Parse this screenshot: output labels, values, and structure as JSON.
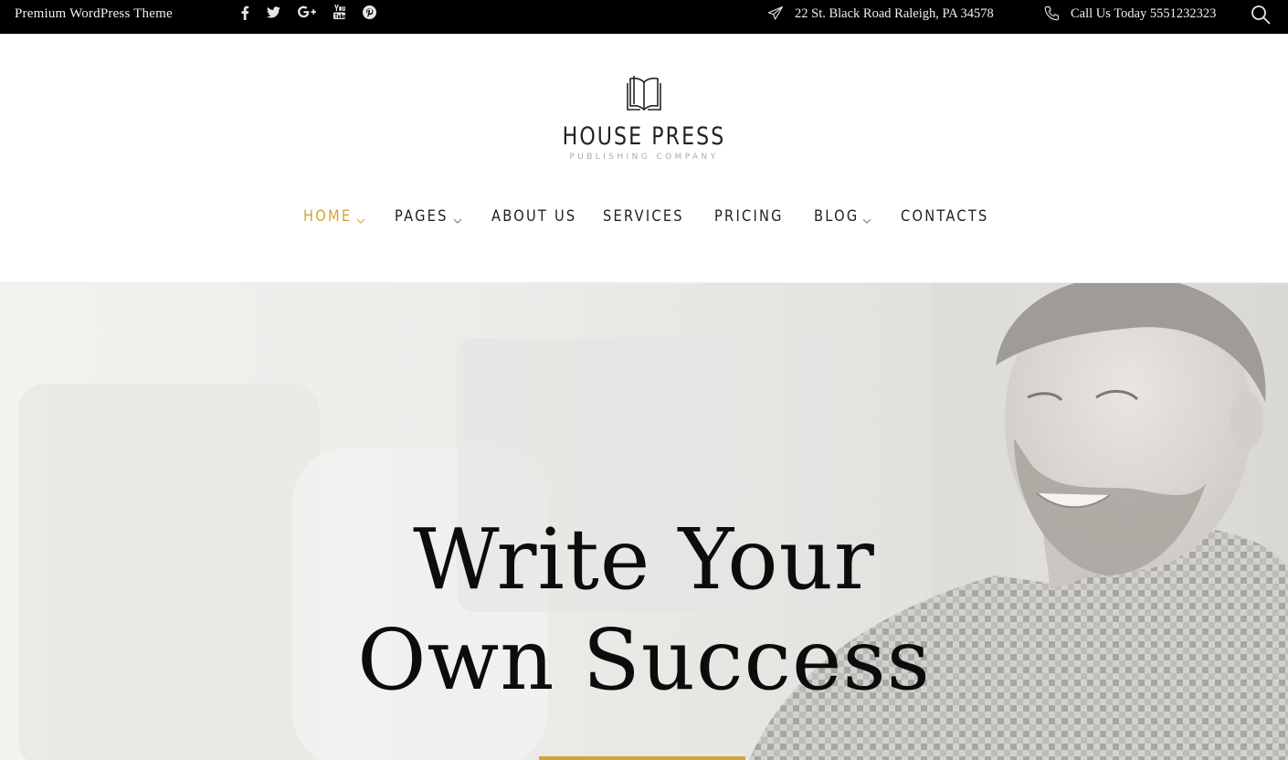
{
  "topbar": {
    "tagline": "Premium WordPress Theme",
    "social": [
      {
        "icon": "facebook-icon",
        "glyph": "f"
      },
      {
        "icon": "twitter-icon",
        "glyph": "t"
      },
      {
        "icon": "google-plus-icon",
        "glyph": "G+"
      },
      {
        "icon": "youtube-icon",
        "glyph": "You"
      },
      {
        "icon": "pinterest-icon",
        "glyph": "P"
      }
    ],
    "address": "22 St. Black Road Raleigh, PA 34578",
    "phone": "Call Us Today 5551232323",
    "address_icon": "paper-plane-icon",
    "phone_icon": "phone-icon",
    "search_icon": "search-icon"
  },
  "logo": {
    "icon": "open-book-icon",
    "title": "HOUSE PRESS",
    "subtitle": "PUBLISHING COMPANY"
  },
  "nav": {
    "items": [
      {
        "label": "HOME",
        "dropdown": true,
        "active": true
      },
      {
        "label": "PAGES",
        "dropdown": true,
        "active": false
      },
      {
        "label": "ABOUT US",
        "dropdown": false,
        "active": false
      },
      {
        "label": "SERVICES",
        "dropdown": false,
        "active": false
      },
      {
        "label": "PRICING",
        "dropdown": false,
        "active": false
      },
      {
        "label": "BLOG",
        "dropdown": true,
        "active": false
      },
      {
        "label": "CONTACTS",
        "dropdown": false,
        "active": false
      }
    ]
  },
  "hero": {
    "title_line1": "Write Your",
    "title_line2": "Own Success"
  },
  "colors": {
    "accent": "#d1a43a",
    "topbar_bg": "#000000",
    "text": "#111111"
  }
}
